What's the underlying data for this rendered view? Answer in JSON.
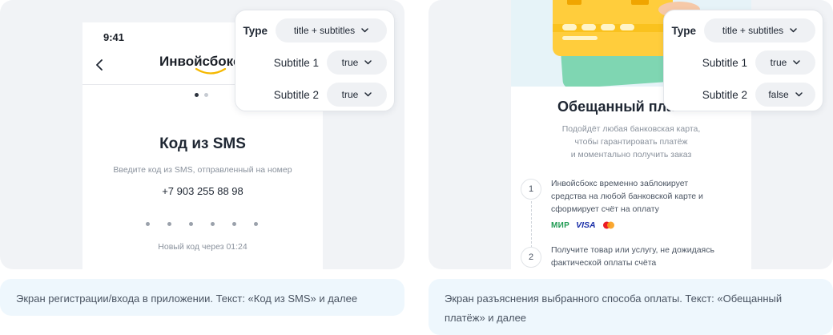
{
  "left_card": {
    "phone": {
      "status_time": "9:41",
      "logo_text": "Инвойсбокс",
      "title": "Код из SMS",
      "subtitle": "Введите код из SMS, отправленный на номер",
      "phone_number": "+7 903 255 88 98",
      "resend_text": "Новый код через 01:24"
    },
    "panel": {
      "type_label": "Type",
      "type_value": "title + subtitles",
      "subtitle1_label": "Subtitle 1",
      "subtitle1_value": "true",
      "subtitle2_label": "Subtitle 2",
      "subtitle2_value": "true"
    },
    "caption": "Экран регистрации/входа в приложении. Текст: «Код из SMS» и далее"
  },
  "right_card": {
    "phone": {
      "title": "Обещанный платёж",
      "subtitle_lines": [
        "Подойдёт любая банковская карта,",
        "чтобы гарантировать платёж",
        "и моментально получить заказ"
      ],
      "step1_number": "1",
      "step1_lines": [
        "Инвойсбокс временно заблокирует",
        "средства на любой банковской карте и",
        "сформирует счёт на оплату"
      ],
      "step2_number": "2",
      "step2_lines": [
        "Получите товар или услугу, не дожидаясь",
        "фактической оплаты счёта"
      ],
      "payment_logos": {
        "mir": "МИР",
        "visa": "VISA",
        "mastercard_icon": "mastercard-icon"
      }
    },
    "panel": {
      "type_label": "Type",
      "type_value": "title + subtitles",
      "subtitle1_label": "Subtitle 1",
      "subtitle1_value": "true",
      "subtitle2_label": "Subtitle 2",
      "subtitle2_value": "false"
    },
    "caption": "Экран разъяснения выбранного способа оплаты. Текст: «Обещанный платёж» и далее"
  },
  "colors": {
    "card_background": "#f1f3f6",
    "caption_background": "#eef7fd",
    "hero_background": "#e6f3f8",
    "select_background": "#eff1f4",
    "logo_accent": "#f5b800"
  }
}
